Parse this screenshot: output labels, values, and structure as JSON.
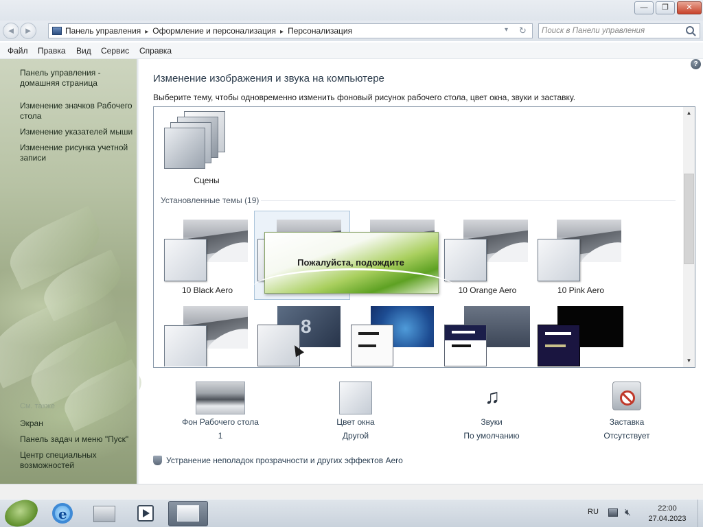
{
  "window": {
    "minimize": "—",
    "maximize": "❐",
    "close": "✕"
  },
  "address": {
    "breadcrumbs": [
      "Панель управления",
      "Оформление и персонализация",
      "Персонализация"
    ],
    "dropdown": "▾",
    "refresh": "↻",
    "search_placeholder": "Поиск в Панели управления"
  },
  "menu": [
    "Файл",
    "Правка",
    "Вид",
    "Сервис",
    "Справка"
  ],
  "sidebar": {
    "links": [
      "Панель управления - домашняя страница",
      "Изменение значков Рабочего стола",
      "Изменение указателей мыши",
      "Изменение рисунка учетной записи"
    ],
    "see_also_title": "См. также",
    "see_also": [
      "Экран",
      "Панель задач и меню \"Пуск\"",
      "Центр специальных возможностей"
    ]
  },
  "main": {
    "help": "?",
    "title": "Изменение изображения и звука на компьютере",
    "subtitle": "Выберите тему, чтобы одновременно изменить фоновый рисунок рабочего стола, цвет окна, звуки и заставку.",
    "scenes_label": "Сцены",
    "installed_group": "Установленные темы (19)",
    "themes_row1": [
      "10 Black Aero",
      "",
      "",
      "10 Orange Aero",
      "10 Pink Aero"
    ],
    "theme8_glyph": "8",
    "wait_text": "Пожалуйста, подождите"
  },
  "options": [
    {
      "title": "Фон Рабочего стола",
      "value": "1"
    },
    {
      "title": "Цвет окна",
      "value": "Другой"
    },
    {
      "title": "Звуки",
      "value": "По умолчанию"
    },
    {
      "title": "Заставка",
      "value": "Отсутствует"
    }
  ],
  "troubleshoot_link": "Устранение неполадок прозрачности и других эффектов Aero",
  "taskbar": {
    "ie_glyph": "e",
    "lang": "RU",
    "time": "22:00",
    "date": "27.04.2023"
  },
  "colors": {
    "accent_green": "#5ea123",
    "link_text": "#2b3f52",
    "close_button": "#c7432b"
  },
  "icons": [
    "back-arrow-icon",
    "forward-arrow-icon",
    "computer-icon",
    "search-icon",
    "help-icon",
    "shield-icon",
    "music-notes-icon",
    "no-screensaver-icon",
    "ie-icon",
    "media-player-icon",
    "folder-icon",
    "control-panel-icon",
    "network-icon",
    "speaker-muted-icon"
  ]
}
